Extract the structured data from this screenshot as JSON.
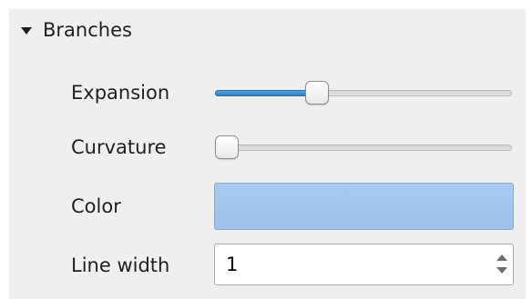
{
  "section": {
    "title": "Branches",
    "expanded": true
  },
  "fields": {
    "expansion": {
      "label": "Expansion",
      "value_fraction": 0.33
    },
    "curvature": {
      "label": "Curvature",
      "value_fraction": 0.0
    },
    "color": {
      "label": "Color",
      "swatch_color": "#9dc1ec"
    },
    "line_width": {
      "label": "Line width",
      "value": "1"
    }
  },
  "colors": {
    "accent": "#3a8bd0",
    "panel_background": "#efefef"
  },
  "icons": {
    "section_toggle": "triangle-down-icon",
    "spin_up": "arrow-up-icon",
    "spin_down": "arrow-down-icon"
  }
}
